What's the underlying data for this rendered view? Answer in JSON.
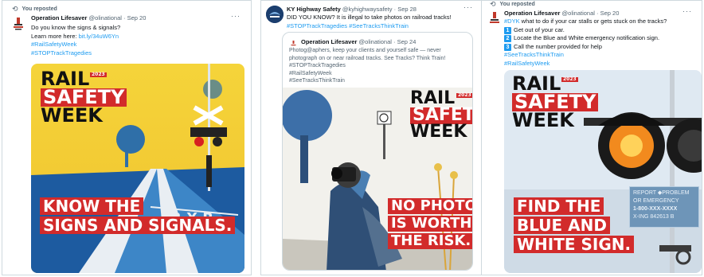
{
  "tweets": [
    {
      "repost_label": "You reposted",
      "author": "Operation Lifesaver",
      "handle": "@olinational · Sep 20",
      "lines": [
        "Do you know the signs & signals?"
      ],
      "learn_prefix": "Learn more here: ",
      "learn_link": "bit.ly/34uW6Yn",
      "hashtags": [
        "#RailSafetyWeek",
        "#STOPTrackTragedies"
      ],
      "image": {
        "logo": [
          "RAIL",
          "SAFETY",
          "WEEK"
        ],
        "logo_side": "2023",
        "banner": [
          "KNOW THE",
          "SIGNS AND SIGNALS."
        ]
      }
    },
    {
      "author": "KY Highway Safety",
      "handle": "@kyhighwaysafety · Sep 28",
      "lines": [
        "DID YOU KNOW? It is illegal to take photos on railroad tracks!"
      ],
      "hashtags_line": "#STOPTrackTragedies #SeeTracksThinkTrain",
      "quote": {
        "author": "Operation Lifesaver",
        "handle": "@olinational · Sep 24",
        "lines": [
          "Photog@aphers, keep your clients and yourself safe — never",
          "photograph on or near railroad tracks. See Tracks? Think Train!",
          "#STOPTrackTragedies",
          "#RailSafetyWeek",
          "#SeeTracksThinkTrain"
        ],
        "image": {
          "logo": [
            "RAIL",
            "SAFETY",
            "WEEK"
          ],
          "logo_side": "2023",
          "banner": [
            "NO PHOTO",
            "IS WORTH",
            "THE RISK."
          ]
        }
      }
    },
    {
      "repost_label": "You reposted",
      "author": "Operation Lifesaver",
      "handle": "@olinational · Sep 20",
      "intro_hashtag": "#DYK",
      "intro_text": " what to do if your car stalls or gets stuck on the tracks?",
      "steps": [
        {
          "num": "1",
          "text": "Get out of your car."
        },
        {
          "num": "2",
          "text": "Locate the Blue and White emergency notification sign."
        },
        {
          "num": "3",
          "text": "Call the number provided for help"
        }
      ],
      "hashtags": [
        "#SeeTracksThinkTrain",
        "#RailSafetyWeek"
      ],
      "image": {
        "logo": [
          "RAIL",
          "SAFETY",
          "WEEK"
        ],
        "logo_side": "2023",
        "banner": [
          "FIND THE",
          "BLUE AND",
          "WHITE SIGN."
        ],
        "sign": [
          "REPORT",
          "PROBLEM",
          "OR EMERGENCY",
          "1-800-XXX-XXXX",
          "X-ING",
          "842613 B"
        ]
      }
    }
  ],
  "colors": {
    "accent": "#1d9bf0",
    "brand_red": "#d22b2b",
    "text": "#0f1419",
    "muted": "#536471"
  }
}
